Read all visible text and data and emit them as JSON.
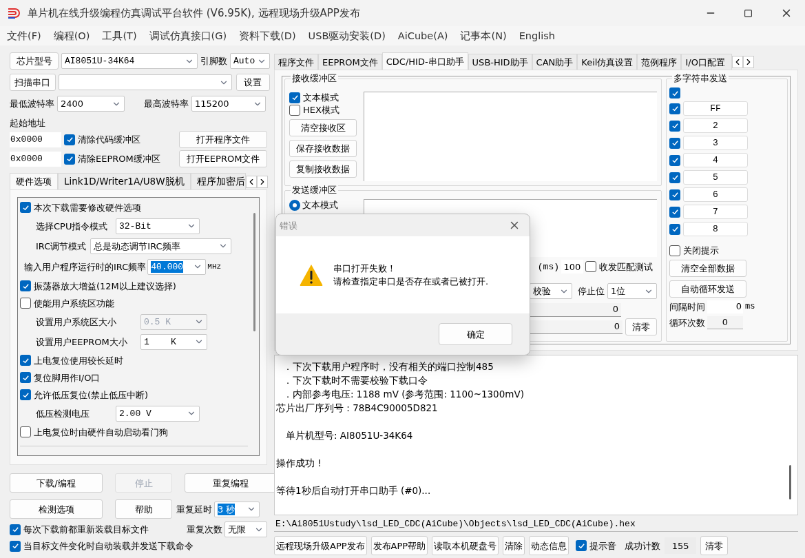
{
  "window": {
    "title": "单片机在线升级编程仿真调试平台软件 (V6.95K), 远程现场升级APP发布"
  },
  "menu": [
    "文件(F)",
    "编程(O)",
    "工具(T)",
    "调试仿真接口(G)",
    "资料下载(D)",
    "USB驱动安装(D)",
    "AiCube(A)",
    "记事本(N)",
    "English"
  ],
  "chip": {
    "model_button": "芯片型号",
    "model": "AI8051U-34K64",
    "pins_label": "引脚数",
    "pins": "Auto",
    "scan_button": "扫描串口",
    "settings_button": "设置"
  },
  "baud": {
    "min_label": "最低波特率",
    "min": "2400",
    "max_label": "最高波特率",
    "max": "115200"
  },
  "address": {
    "label": "起始地址",
    "rows": [
      {
        "value": "0x0000",
        "checkbox": "清除代码缓冲区",
        "checked": true,
        "button": "打开程序文件"
      },
      {
        "value": "0x0000",
        "checkbox": "清除EEPROM缓冲区",
        "checked": true,
        "button": "打开EEPROM文件"
      }
    ]
  },
  "left_tabs": [
    {
      "label": "硬件选项",
      "selected": true
    },
    {
      "label": "Link1D/Writer1A/U8W脱机",
      "selected": false
    },
    {
      "label": "程序加密后",
      "selected": false
    }
  ],
  "hardware_options": [
    {
      "kind": "checkbox",
      "label": "本次下载需要修改硬件选项",
      "checked": true
    },
    {
      "kind": "select",
      "label": "选择CPU指令模式",
      "value": "32-Bit",
      "disabled": false
    },
    {
      "kind": "select",
      "label": "IRC调节模式",
      "value": "总是动态调节IRC频率",
      "disabled": false
    },
    {
      "kind": "freq",
      "label": "输入用户程序运行时的IRC频率",
      "value": "40.000",
      "unit": "MHz"
    },
    {
      "kind": "checkbox",
      "label": "振荡器放大增益(12M以上建议选择)",
      "checked": true
    },
    {
      "kind": "checkbox",
      "label": "使能用户系统区功能",
      "checked": false
    },
    {
      "kind": "select",
      "label": "设置用户系统区大小",
      "value": "0.5 K",
      "disabled": true
    },
    {
      "kind": "select",
      "label": "设置用户EEPROM大小",
      "value": "1    K",
      "disabled": false
    },
    {
      "kind": "checkbox",
      "label": "上电复位使用较长延时",
      "checked": true
    },
    {
      "kind": "checkbox",
      "label": "复位脚用作I/O口",
      "checked": true
    },
    {
      "kind": "checkbox",
      "label": "允许低压复位(禁止低压中断)",
      "checked": true
    },
    {
      "kind": "select",
      "label": "低压检测电压",
      "value": "2.00 V",
      "disabled": false
    },
    {
      "kind": "checkbox",
      "label": "上电复位时由硬件自动启动看门狗",
      "checked": false
    }
  ],
  "actions": [
    {
      "label": "下载/编程",
      "disabled": false
    },
    {
      "label": "停止",
      "disabled": true
    },
    {
      "label": "重复编程",
      "disabled": false
    },
    {
      "label": "检测选项",
      "disabled": false
    },
    {
      "label": "帮助",
      "disabled": false
    }
  ],
  "repeat": {
    "delay_label": "重复延时",
    "delay": "3 秒",
    "count_label": "重复次数",
    "count": "无限"
  },
  "bottom_checks": [
    {
      "label": "每次下载前都重新装载目标文件",
      "checked": true
    },
    {
      "label": "当目标文件变化时自动装载并发送下载命令",
      "checked": true
    }
  ],
  "right_tabs": [
    {
      "label": "程序文件",
      "selected": false
    },
    {
      "label": "EEPROM文件",
      "selected": false
    },
    {
      "label": "CDC/HID-串口助手",
      "selected": true
    },
    {
      "label": "USB-HID助手",
      "selected": false
    },
    {
      "label": "CAN助手",
      "selected": false
    },
    {
      "label": "Keil仿真设置",
      "selected": false
    },
    {
      "label": "范例程序",
      "selected": false
    },
    {
      "label": "I/O口配置",
      "selected": false
    }
  ],
  "receive": {
    "title": "接收缓冲区",
    "modes": [
      {
        "label": "文本模式",
        "checked": true
      },
      {
        "label": "HEX模式",
        "checked": false
      }
    ],
    "buttons": [
      "清空接收区",
      "保存接收数据",
      "复制接收数据"
    ]
  },
  "send": {
    "title": "发送缓冲区",
    "mode": {
      "label": "文本模式",
      "selected": true
    },
    "interval_unit": "(ms)",
    "interval": "100",
    "match_test": {
      "label": "收发匹配测试",
      "checked": false
    },
    "parity": "校验",
    "stop_label": "停止位",
    "stop": "1位",
    "counters": [
      "0",
      "0"
    ],
    "clear_button": "清零"
  },
  "multi_send": {
    "title": "多字符串发送",
    "all_checked": true,
    "items": [
      {
        "value": "FF",
        "checked": true
      },
      {
        "value": "2",
        "checked": true
      },
      {
        "value": "3",
        "checked": true
      },
      {
        "value": "4",
        "checked": true
      },
      {
        "value": "5",
        "checked": true
      },
      {
        "value": "6",
        "checked": true
      },
      {
        "value": "7",
        "checked": true
      },
      {
        "value": "8",
        "checked": true
      }
    ],
    "close_tip": {
      "label": "关闭提示",
      "checked": false
    },
    "buttons": [
      "清空全部数据",
      "自动循环发送"
    ],
    "interval_label": "间隔时间",
    "interval": "0",
    "interval_unit": "ms",
    "loop_label": "循环次数",
    "loop": "0"
  },
  "log": [
    {
      "kind": "bullet",
      "text": "．下次下载用户程序时，没有相关的端口控制485",
      "space_before": false
    },
    {
      "kind": "bullet",
      "text": "．下次下载时不需要校验下载口令",
      "space_before": false
    },
    {
      "kind": "bullet",
      "text": "．内部参考电压: 1188 mV (参考范围: 1100~1300mV)",
      "space_before": false
    },
    {
      "kind": "plain",
      "text": "芯片出厂序列号 : 78B4C90005D821",
      "space_before": false
    },
    {
      "kind": "indent",
      "text": "单片机型号: AI8051U-34K64",
      "space_before": true
    },
    {
      "kind": "plain",
      "text": "操作成功 !",
      "space_before": true
    },
    {
      "kind": "plain",
      "text": "等待1秒后自动打开串口助手 (#0)...",
      "space_before": true
    }
  ],
  "path": "E:\\Ai8051Ustudy\\lsd_LED_CDC(AiCube)\\Objects\\lsd_LED_CDC(AiCube).hex",
  "bottom_bar": {
    "buttons": [
      "远程现场升级APP发布",
      "发布APP帮助",
      "读取本机硬盘号",
      "清除",
      "动态信息"
    ],
    "sound": {
      "label": "提示音",
      "checked": true
    },
    "count_label": "成功计数",
    "count": "155",
    "clear_button": "清零"
  },
  "dialog": {
    "title": "错误",
    "lines": [
      "串口打开失败！",
      "请检查指定串口是否存在或者已被打开."
    ],
    "button": "确定"
  }
}
